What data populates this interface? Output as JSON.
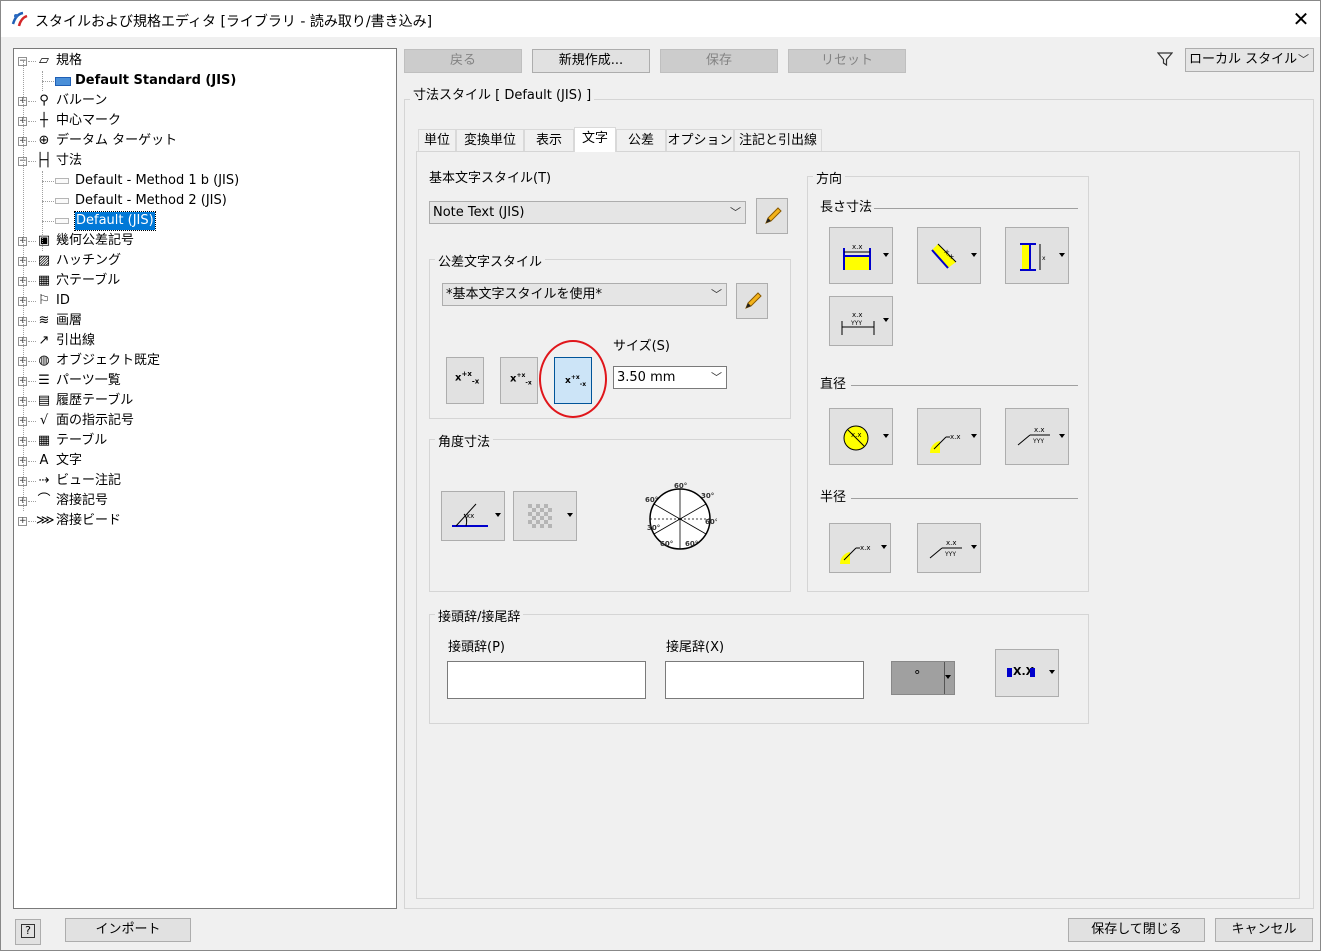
{
  "window": {
    "title": "スタイルおよび規格エディタ [ライブラリ - 読み取り/書き込み]"
  },
  "tree": {
    "items": [
      {
        "label": "規格",
        "expanded": true,
        "icon": "standard-icon"
      },
      {
        "label": "Default Standard (JIS)",
        "bold": true,
        "icon": "active-standard-icon"
      },
      {
        "label": "バルーン",
        "icon": "balloon-icon"
      },
      {
        "label": "中心マーク",
        "icon": "center-mark-icon"
      },
      {
        "label": "データム ターゲット",
        "icon": "datum-target-icon"
      },
      {
        "label": "寸法",
        "expanded": true,
        "icon": "dimension-icon"
      },
      {
        "label": "Default - Method 1 b (JIS)",
        "icon": "style-icon"
      },
      {
        "label": "Default - Method 2 (JIS)",
        "icon": "style-icon"
      },
      {
        "label": "Default (JIS)",
        "selected": true,
        "icon": "style-icon"
      },
      {
        "label": "幾何公差記号",
        "icon": "feature-control-frame-icon"
      },
      {
        "label": "ハッチング",
        "icon": "hatch-icon"
      },
      {
        "label": "穴テーブル",
        "icon": "hole-table-icon"
      },
      {
        "label": "ID",
        "icon": "id-icon"
      },
      {
        "label": "画層",
        "icon": "layers-icon"
      },
      {
        "label": "引出線",
        "icon": "leader-icon"
      },
      {
        "label": "オブジェクト既定",
        "icon": "object-defaults-icon"
      },
      {
        "label": "パーツ一覧",
        "icon": "parts-list-icon"
      },
      {
        "label": "履歴テーブル",
        "icon": "revision-table-icon"
      },
      {
        "label": "面の指示記号",
        "icon": "surface-texture-icon"
      },
      {
        "label": "テーブル",
        "icon": "table-icon"
      },
      {
        "label": "文字",
        "icon": "text-icon"
      },
      {
        "label": "ビュー注記",
        "icon": "view-annotation-icon"
      },
      {
        "label": "溶接記号",
        "icon": "weld-symbol-icon"
      },
      {
        "label": "溶接ビード",
        "icon": "weld-bead-icon"
      }
    ]
  },
  "toolbar": {
    "back": "戻る",
    "new": "新規作成...",
    "save": "保存",
    "reset": "リセット",
    "filter_value": "ローカル スタイル"
  },
  "style_group_title": "寸法スタイル [ Default (JIS) ]",
  "tabs": [
    "単位",
    "変換単位",
    "表示",
    "文字",
    "公差",
    "オプション",
    "注記と引出線"
  ],
  "active_tab": "文字",
  "text": {
    "primary_text_style_label": "基本文字スタイル(T)",
    "primary_text_style_value": "Note Text (JIS)",
    "tolerance_group_label": "公差文字スタイル",
    "tolerance_style_value": "*基本文字スタイルを使用*",
    "size_label": "サイズ(S)",
    "size_value": "3.50 mm",
    "angle_group_label": "角度寸法",
    "direction_group_label": "方向",
    "linear_label": "長さ寸法",
    "diameter_label": "直径",
    "radius_label": "半径",
    "prefix_suffix_group_label": "接頭辞/接尾辞",
    "prefix_label": "接頭辞(P)",
    "suffix_label": "接尾辞(X)",
    "prefix_value": "",
    "suffix_value": "",
    "symbol_button_glyph": "°",
    "format_button_text": "X.X",
    "angle_dial_labels": [
      "60°",
      "30°",
      "60°",
      "60°",
      "60°",
      "30°",
      "60°"
    ]
  },
  "footer": {
    "help": "?",
    "import": "インポート",
    "save_close": "保存して閉じる",
    "cancel": "キャンセル"
  },
  "colors": {
    "selected_bg": "#0078d7",
    "highlight_circle": "#e0161b",
    "icon_yellow": "#ffff00",
    "icon_blue": "#0000cc"
  }
}
